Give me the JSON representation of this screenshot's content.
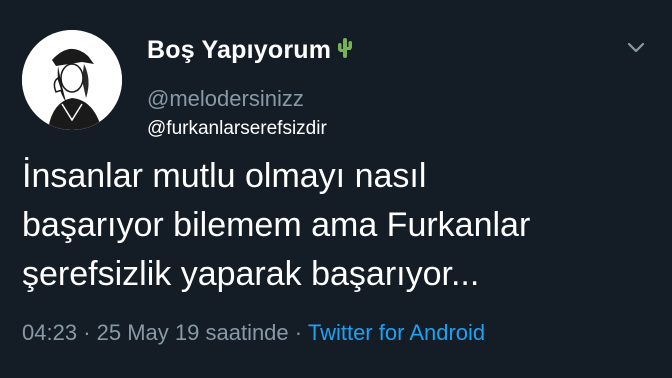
{
  "tweet": {
    "display_name": "Boş Yapıyorum",
    "name_emoji_icon": "cactus-icon",
    "handle": "@melodersinizz",
    "reply_to": "@furkanlarserefsizdir",
    "menu_icon": "chevron-down-icon",
    "body_lines": [
      "İnsanlar mutlu olmayı nasıl",
      "başarıyor bilemem ama Furkanlar",
      "şerefsizlik yaparak başarıyor..."
    ],
    "time": "04:23",
    "separator": "·",
    "date": "25 May 19 saatinde",
    "source": "Twitter for Android"
  },
  "colors": {
    "background": "#141d26",
    "text": "#ffffff",
    "muted": "#8899a6",
    "link": "#1da1f2",
    "cactus": "#77b255"
  }
}
